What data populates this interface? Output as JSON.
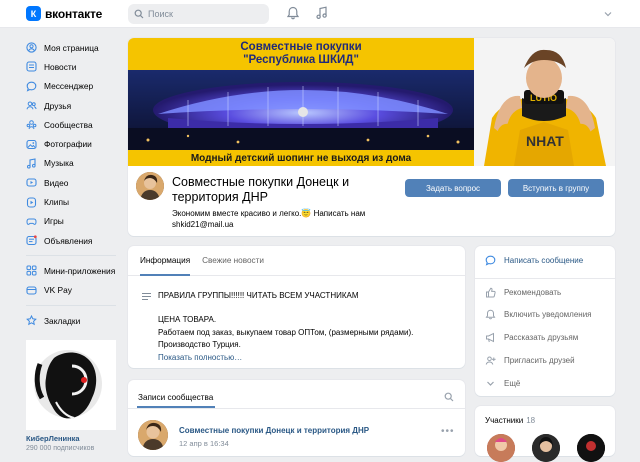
{
  "topbar": {
    "logo_letter": "К",
    "logo_text": "вконтакте",
    "search_placeholder": "Поиск"
  },
  "sidebar": {
    "items": [
      {
        "label": "Моя страница",
        "icon": "user-icon"
      },
      {
        "label": "Новости",
        "icon": "news-icon"
      },
      {
        "label": "Мессенджер",
        "icon": "chat-icon"
      },
      {
        "label": "Друзья",
        "icon": "friends-icon"
      },
      {
        "label": "Сообщества",
        "icon": "communities-icon"
      },
      {
        "label": "Фотографии",
        "icon": "photo-icon"
      },
      {
        "label": "Музыка",
        "icon": "music-icon"
      },
      {
        "label": "Видео",
        "icon": "video-icon"
      },
      {
        "label": "Клипы",
        "icon": "clips-icon"
      },
      {
        "label": "Игры",
        "icon": "games-icon"
      },
      {
        "label": "Объявления",
        "icon": "ads-icon"
      }
    ],
    "extra": [
      {
        "label": "Мини-приложения",
        "icon": "apps-icon"
      },
      {
        "label": "VK Pay",
        "icon": "vkpay-icon"
      }
    ],
    "bookmarks": {
      "label": "Закладки",
      "icon": "bookmark-icon"
    },
    "promo": {
      "name": "КиберЛенинка",
      "subscribers": "290 000 подписчиков"
    }
  },
  "cover": {
    "title_line1": "Совместные покупки",
    "title_line2": "\"Республика  ШКИД\"",
    "bottom_text": "Модный детский шопинг не выходя из дома"
  },
  "group": {
    "title": "Совместные покупки Донецк и территория ДНР",
    "status": "Экономим вместе красиво и легко.😇 Написать нам shkid21@mail.ua",
    "ask_button": "Задать вопрос",
    "join_button": "Вступить в группу"
  },
  "info": {
    "tabs": [
      "Информация",
      "Свежие новости"
    ],
    "rules": "ПРАВИЛА ГРУППЫ!!!!!! ЧИТАТЬ ВСЕМ УЧАСТНИКАМ",
    "desc_line1": "ЦЕНА ТОВАРА.",
    "desc_line2": "Работаем под заказ, выкупаем товар ОПТом, (размерными рядами).",
    "desc_line3": "Производство Турция.",
    "show_more": "Показать полностью…"
  },
  "actions": {
    "send_message": "Написать сообщение",
    "recommend": "Рекомендовать",
    "notifications": "Включить уведомления",
    "tell_friends": "Рассказать друзьям",
    "invite_friends": "Пригласить друзей",
    "more": "Ещё"
  },
  "posts": {
    "header": "Записи сообщества",
    "author": "Совместные покупки Донецк и территория ДНР",
    "date": "12 апр в 16:34",
    "more": "•••"
  },
  "members": {
    "label": "Участники",
    "count": "18"
  },
  "colors": {
    "accent": "#5181b8",
    "link": "#2a5885",
    "background": "#edeef0",
    "cover_yellow": "#f5c400"
  }
}
